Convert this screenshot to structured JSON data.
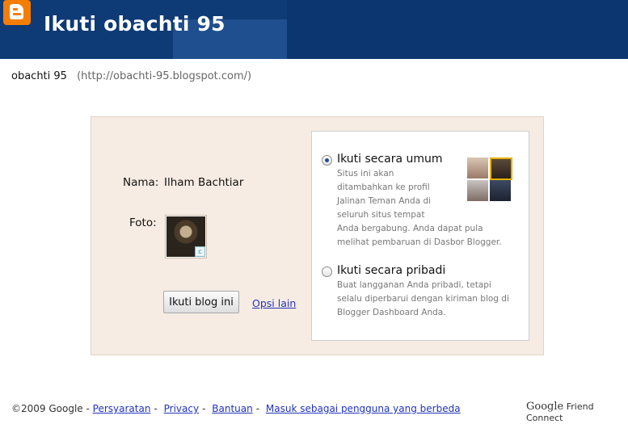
{
  "header": {
    "title": "Ikuti obachti 95",
    "logo_icon": "blogger-logo-icon"
  },
  "blog": {
    "name": "obachti 95",
    "url": "(http://obachti-95.blogspot.com/)"
  },
  "form": {
    "name_label": "Nama:",
    "name_value": "Ilham Bachtiar",
    "photo_label": "Foto:",
    "follow_button": "Ikuti blog ini",
    "other_options_link": "Opsi lain"
  },
  "options": {
    "public": {
      "selected": true,
      "title": "Ikuti secara umum",
      "desc_lines": [
        "Situs ini akan",
        "ditambahkan ke profil",
        "Jalinan Teman Anda di",
        "seluruh situs tempat",
        "Anda bergabung. Anda dapat pula",
        "melihat pembaruan di Dasbor Blogger."
      ]
    },
    "private": {
      "selected": false,
      "title": "Ikuti secara pribadi",
      "desc_lines": [
        "Buat langganan Anda pribadi, tetapi",
        "selalu diperbarui dengan kiriman blog di",
        "Blogger Dashboard Anda."
      ]
    }
  },
  "footer": {
    "copyright": "©2009 Google -",
    "links": [
      "Persyaratan",
      "Privacy",
      "Bantuan",
      "Masuk sebagai pengguna yang berbeda"
    ],
    "brand_google": "Google",
    "brand_fc": "Friend Connect"
  },
  "colors": {
    "header_bg": "#0e3a75",
    "panel_bg": "#f6ece3",
    "link": "#2233bb",
    "logo_orange": "#f57d00"
  }
}
